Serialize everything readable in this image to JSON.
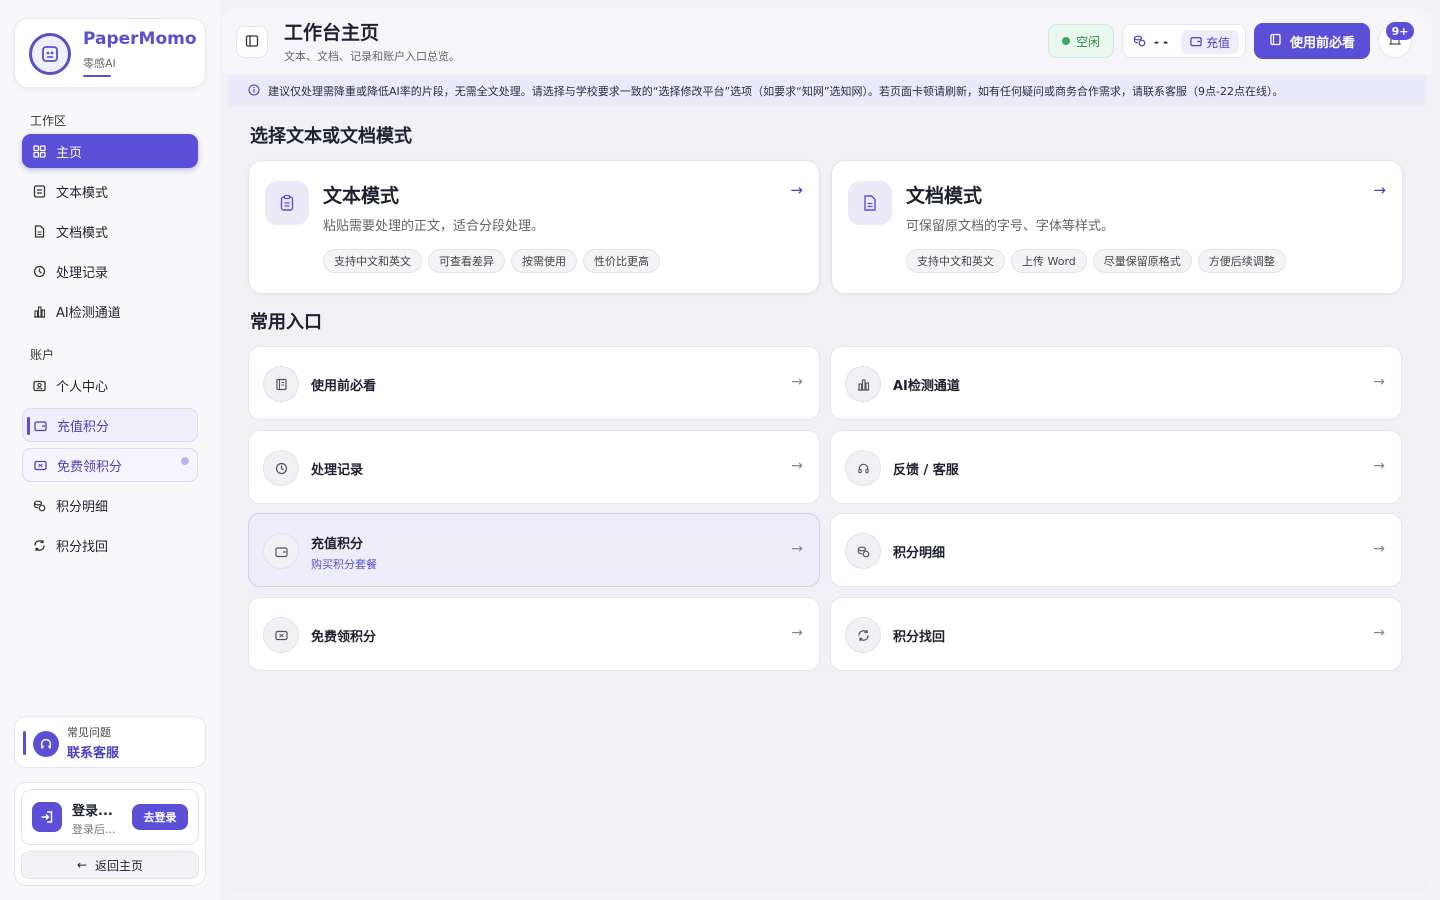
{
  "brand": {
    "name": "PaperMomo",
    "sub": "零感AI",
    "logo_icon": "brand-logo-icon"
  },
  "sidebar": {
    "section_work": "工作区",
    "section_account": "账户",
    "items": [
      {
        "label": "主页",
        "icon": "grid-icon"
      },
      {
        "label": "文本模式",
        "icon": "text-doc-icon"
      },
      {
        "label": "文档模式",
        "icon": "file-icon"
      },
      {
        "label": "处理记录",
        "icon": "history-icon"
      },
      {
        "label": "AI检测通道",
        "icon": "chart-icon"
      },
      {
        "label": "个人中心",
        "icon": "user-card-icon"
      },
      {
        "label": "充值积分",
        "icon": "wallet-icon"
      },
      {
        "label": "免费领积分",
        "icon": "ticket-icon"
      },
      {
        "label": "积分明细",
        "icon": "coins-icon"
      },
      {
        "label": "积分找回",
        "icon": "refresh-icon"
      }
    ],
    "faq": {
      "title": "常见问题",
      "link": "联系客服"
    },
    "login": {
      "name": "登录...",
      "desc": "登录后...",
      "button": "去登录",
      "back": "返回主页"
    }
  },
  "header": {
    "title": "工作台主页",
    "subtitle": "文本、文档、记录和账户入口总览。",
    "status": "空闲",
    "credit_value": "- -",
    "recharge": "充值",
    "must_read": "使用前必看",
    "badge": "9+"
  },
  "notice": "建议仅处理需降重或降低AI率的片段，无需全文处理。请选择与学校要求一致的“选择修改平台”选项（如要求“知网”选知网）。若页面卡顿请刷新，如有任何疑问或商务合作需求，请联系客服（9点-22点在线）。",
  "modes": {
    "heading": "选择文本或文档模式",
    "text": {
      "title": "文本模式",
      "desc": "粘贴需要处理的正文，适合分段处理。",
      "tags": [
        "支持中文和英文",
        "可查看差异",
        "按需使用",
        "性价比更高"
      ]
    },
    "doc": {
      "title": "文档模式",
      "desc": "可保留原文档的字号、字体等样式。",
      "tags": [
        "支持中文和英文",
        "上传 Word",
        "尽量保留原格式",
        "方便后续调整"
      ]
    }
  },
  "entries": {
    "heading": "常用入口",
    "items": [
      {
        "label": "使用前必看",
        "sub": "",
        "icon": "book-icon"
      },
      {
        "label": "AI检测通道",
        "sub": "",
        "icon": "chart-icon"
      },
      {
        "label": "处理记录",
        "sub": "",
        "icon": "history-icon"
      },
      {
        "label": "反馈 / 客服",
        "sub": "",
        "icon": "headset-icon"
      },
      {
        "label": "充值积分",
        "sub": "购买积分套餐",
        "icon": "wallet-icon"
      },
      {
        "label": "积分明细",
        "sub": "",
        "icon": "coins-icon"
      },
      {
        "label": "免费领积分",
        "sub": "",
        "icon": "ticket-icon"
      },
      {
        "label": "积分找回",
        "sub": "",
        "icon": "refresh-icon"
      }
    ]
  },
  "colors": {
    "accent": "#5a4fd6",
    "idle": "#3aaa5a"
  }
}
